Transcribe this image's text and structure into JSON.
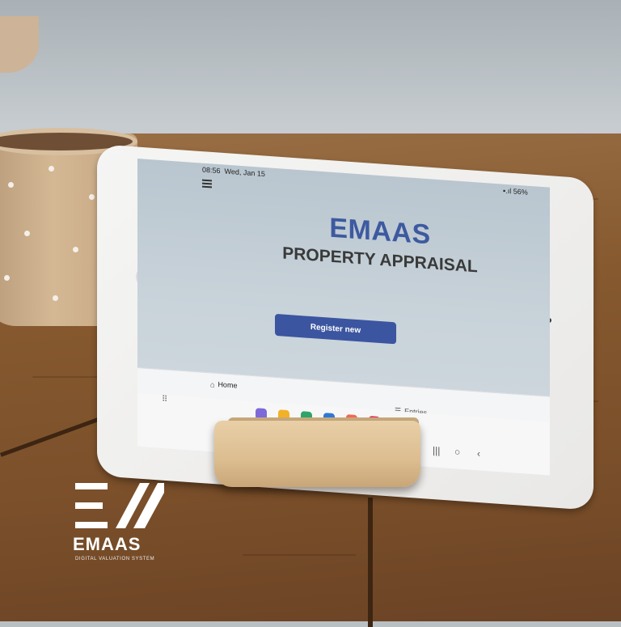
{
  "status_bar": {
    "time": "08:56",
    "date": "Wed, Jan 15",
    "battery": "56%"
  },
  "app": {
    "title": "EMAAS",
    "subtitle": "PROPERTY APPRAISAL",
    "register_button": "Register new"
  },
  "bottom_nav": {
    "home_label": "Home",
    "entries_label": "Entries"
  },
  "dock": {
    "app_colors": [
      "#7d6ad8",
      "#f2b227",
      "#2ea46b",
      "#2f79d6",
      "#ef6a55",
      "#e0355b"
    ]
  },
  "logo": {
    "name": "EMAAS",
    "tagline": "DIGITAL VALUATION SYSTEM"
  },
  "colors": {
    "brand": "#3d5aa0",
    "button": "#3b55a0"
  }
}
